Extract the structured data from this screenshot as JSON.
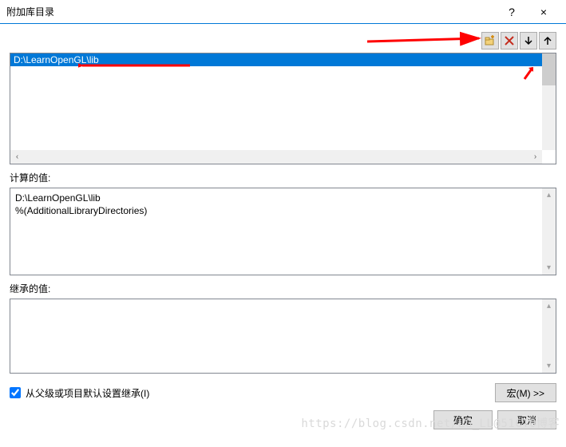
{
  "title": "附加库目录",
  "titlebar": {
    "help": "?",
    "close": "×"
  },
  "toolbar": {
    "new_icon": "new-folder-icon",
    "delete_icon": "delete-icon",
    "down_icon": "move-down-icon",
    "up_icon": "move-up-icon"
  },
  "list": {
    "items": [
      "D:\\LearnOpenGL\\lib"
    ],
    "selected_index": 0
  },
  "computed": {
    "label": "计算的值:",
    "lines": [
      "D:\\LearnOpenGL\\lib",
      "%(AdditionalLibraryDirectories)"
    ]
  },
  "inherited": {
    "label": "继承的值:",
    "lines": []
  },
  "checkbox": {
    "label": "从父级或项目默认设置继承(I)",
    "checked": true
  },
  "buttons": {
    "macros": "宏(M) >>",
    "ok": "确定",
    "cancel": "取消"
  },
  "watermark": "https://blog.csdn.net/LG_LL@51CTO博客"
}
